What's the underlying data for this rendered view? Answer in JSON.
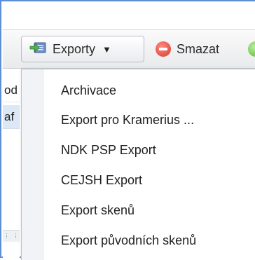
{
  "toolbar": {
    "export_label": "Exporty",
    "delete_label": "Smazat"
  },
  "grid": {
    "rows": [
      "od",
      "af"
    ]
  },
  "export_menu": {
    "items": [
      "Archivace",
      "Export pro Kramerius ...",
      "NDK PSP Export",
      "CEJSH Export",
      "Export skenů",
      "Export původních skenů"
    ]
  }
}
